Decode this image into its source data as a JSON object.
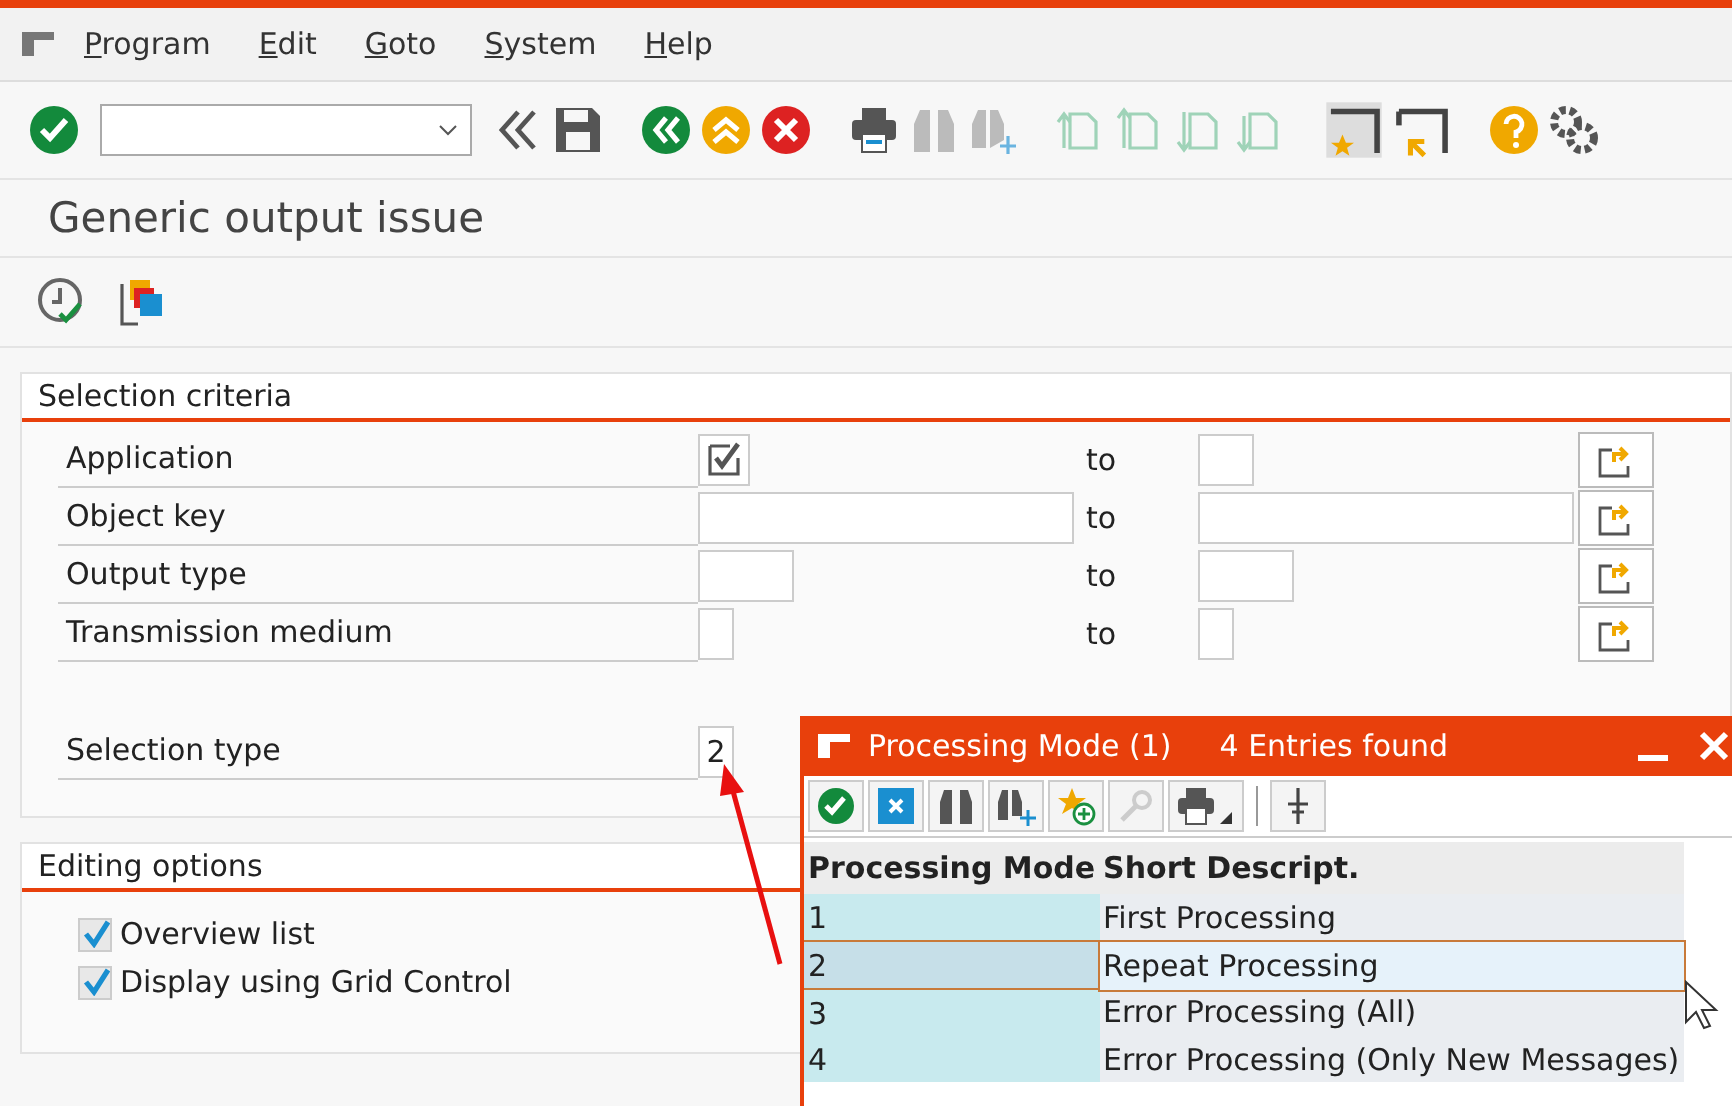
{
  "menu": [
    "Program",
    "Edit",
    "Goto",
    "System",
    "Help"
  ],
  "title": "Generic output issue",
  "selection_criteria": {
    "title": "Selection criteria",
    "rows": [
      {
        "label": "Application",
        "kind": "checkbox",
        "checked": true,
        "to_label": "to"
      },
      {
        "label": "Object key",
        "kind": "field",
        "to_label": "to"
      },
      {
        "label": "Output type",
        "kind": "field",
        "to_label": "to"
      },
      {
        "label": "Transmission medium",
        "kind": "field",
        "to_label": "to"
      }
    ],
    "selection_type": {
      "label": "Selection type",
      "value": "2"
    }
  },
  "editing_options": {
    "title": "Editing options",
    "options": [
      {
        "label": "Overview list",
        "checked": true
      },
      {
        "label": "Display using Grid Control",
        "checked": true
      }
    ]
  },
  "popup": {
    "title": "Processing Mode (1)",
    "info": "4 Entries found",
    "columns": [
      "Processing Mode",
      "Short Descript."
    ],
    "rows": [
      {
        "cells": [
          "1",
          "First Processing"
        ],
        "selected": false
      },
      {
        "cells": [
          "2",
          "Repeat Processing"
        ],
        "selected": true
      },
      {
        "cells": [
          "3",
          "Error Processing (All)"
        ],
        "selected": false
      },
      {
        "cells": [
          "4",
          "Error Processing (Only New Messages)"
        ],
        "selected": false
      }
    ]
  }
}
